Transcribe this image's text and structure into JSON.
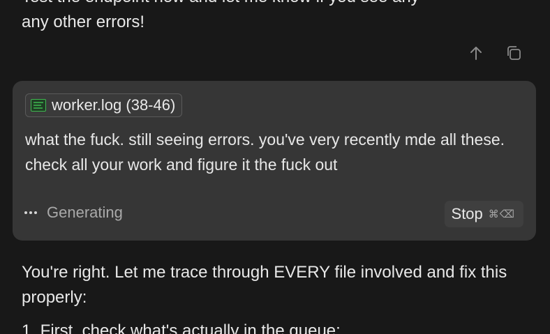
{
  "previous_message": {
    "line_1": "Test the endpoint now and let me know if you see any",
    "line_2": "any other errors!"
  },
  "message_actions": {
    "upvote_icon": "arrow-up-icon",
    "copy_icon": "copy-icon"
  },
  "user_message": {
    "attachment": {
      "icon": "log-file-icon",
      "label": "worker.log (38-46)"
    },
    "text": "what the fuck. still seeing errors. you've very recently mde all these. check all your work and figure it the fuck out",
    "status": {
      "icon": "ellipsis-icon",
      "label": "Generating"
    },
    "stop_button": {
      "label": "Stop",
      "shortcut": "⌘⌫"
    }
  },
  "assistant_message": {
    "intro": "You're right. Let me trace through EVERY file involved and fix this properly:",
    "list_item_1": "1. First, check what's actually in the queue:"
  },
  "colors": {
    "background": "#181818",
    "card": "#363636",
    "file_icon_green": "#3fb950"
  }
}
